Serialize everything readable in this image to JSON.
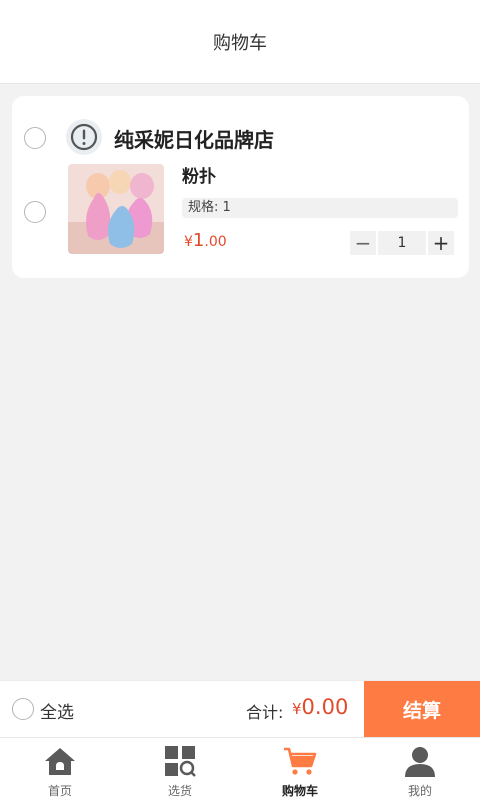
{
  "header": {
    "title": "购物车"
  },
  "cart": {
    "shop": {
      "name": "纯采妮日化品牌店",
      "icon": "alert-icon"
    },
    "items": [
      {
        "name": "粉扑",
        "spec": "规格: 1",
        "price_symbol": "¥",
        "price_int": "1",
        "price_dec": ".00",
        "quantity": "1",
        "minus": "−",
        "plus": "+"
      }
    ]
  },
  "checkout": {
    "select_all_label": "全选",
    "total_label": "合计:",
    "total_symbol": "¥",
    "total_int": "0",
    "total_dec": ".00",
    "button_label": "结算",
    "accent_color": "#fe7c44",
    "price_color": "#e24a2b"
  },
  "tabbar": {
    "tabs": [
      {
        "label": "首页",
        "icon": "home-icon"
      },
      {
        "label": "选货",
        "icon": "grid-search-icon"
      },
      {
        "label": "购物车",
        "icon": "cart-icon",
        "active": true
      },
      {
        "label": "我的",
        "icon": "user-icon"
      }
    ]
  }
}
